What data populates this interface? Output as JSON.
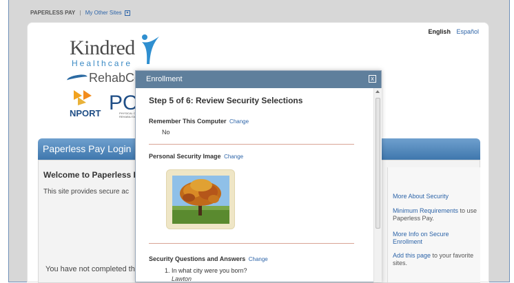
{
  "topbar": {
    "brand": "PAPERLESS PAY",
    "separator": "|",
    "other_sites": "My Other Sites"
  },
  "lang": {
    "english": "English",
    "espanol": "Español"
  },
  "logos": {
    "kindred": "Kindred",
    "healthcare": "Healthcare",
    "rehab": "RehabCo",
    "nport": "NPORT",
    "po": "PO",
    "po_sub1": "PHYSICAL OCCU",
    "po_sub2": "REHABILITATION"
  },
  "login": {
    "header": "Paperless Pay Login",
    "welcome": "Welcome to Paperless P",
    "provides": "This site provides secure ac",
    "not_completed": "You have not completed th"
  },
  "right_links": {
    "about_security": "More About Security",
    "min_req_link": "Minimum Requirements",
    "min_req_rest": " to use Paperless Pay.",
    "more_info": "More Info on Secure Enrollment",
    "add_page_link": "Add this page",
    "add_page_rest": " to your favorite sites."
  },
  "modal": {
    "title": "Enrollment",
    "close": "x",
    "step": "Step 5 of 6: Review Security Selections",
    "remember_label": "Remember This Computer",
    "change": "Change",
    "remember_value": "No",
    "image_label": "Personal Security Image",
    "qa_label": "Security Questions and Answers",
    "q1": "1. In what city were you born?",
    "a1": "Lawton"
  },
  "icons": {
    "dropdown": "chevron-down-icon",
    "close": "close-icon"
  }
}
